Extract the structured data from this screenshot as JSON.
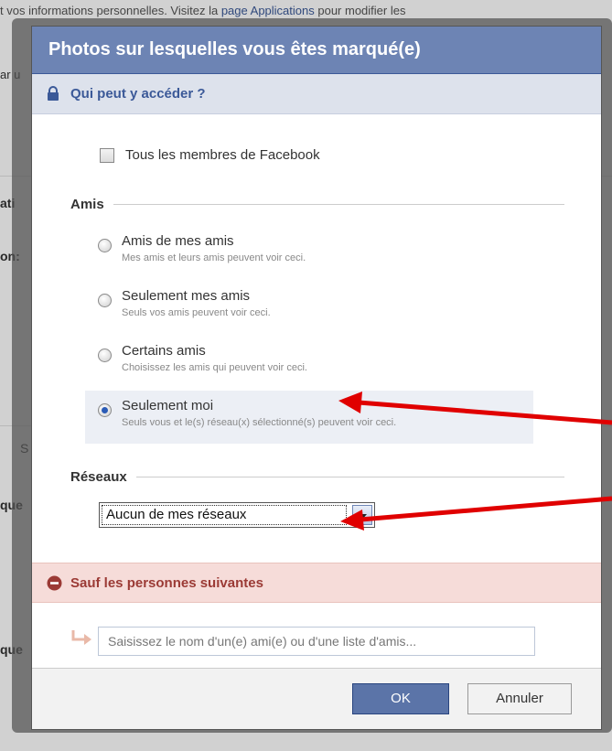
{
  "background": {
    "top_text_before": "t vos informations personnelles. Visitez la ",
    "top_link": "page Applications",
    "top_text_after": " pour modifier les",
    "left_fragments": [
      {
        "text": "ar u",
        "row": 0
      },
      {
        "text": "ati",
        "row": 1
      },
      {
        "text": "on:",
        "row": 2
      },
      {
        "text": "S",
        "row": 3
      },
      {
        "text": "que",
        "row": 4
      },
      {
        "text": "que",
        "row": 5
      }
    ]
  },
  "dialog": {
    "title": "Photos sur lesquelles vous êtes marqué(e)",
    "access_header": "Qui peut y accéder ?",
    "everyone_label": "Tous les membres de Facebook",
    "friends_group_title": "Amis",
    "options": [
      {
        "label": "Amis de mes amis",
        "desc": "Mes amis et leurs amis peuvent voir ceci.",
        "selected": false
      },
      {
        "label": "Seulement mes amis",
        "desc": "Seuls vos amis peuvent voir ceci.",
        "selected": false
      },
      {
        "label": "Certains amis",
        "desc": "Choisissez les amis qui peuvent voir ceci.",
        "selected": false
      },
      {
        "label": "Seulement moi",
        "desc": "Seuls vous et le(s) réseau(x) sélectionné(s) peuvent voir ceci.",
        "selected": true
      }
    ],
    "networks_group_title": "Réseaux",
    "networks_select_value": "Aucun de mes réseaux",
    "except_header": "Sauf les personnes suivantes",
    "except_placeholder": "Saisissez le nom d'un(e) ami(e) ou d'une liste d'amis...",
    "ok_label": "OK",
    "cancel_label": "Annuler"
  },
  "colors": {
    "header_bg": "#6d84b4",
    "annotation_arrow": "#e00000"
  }
}
